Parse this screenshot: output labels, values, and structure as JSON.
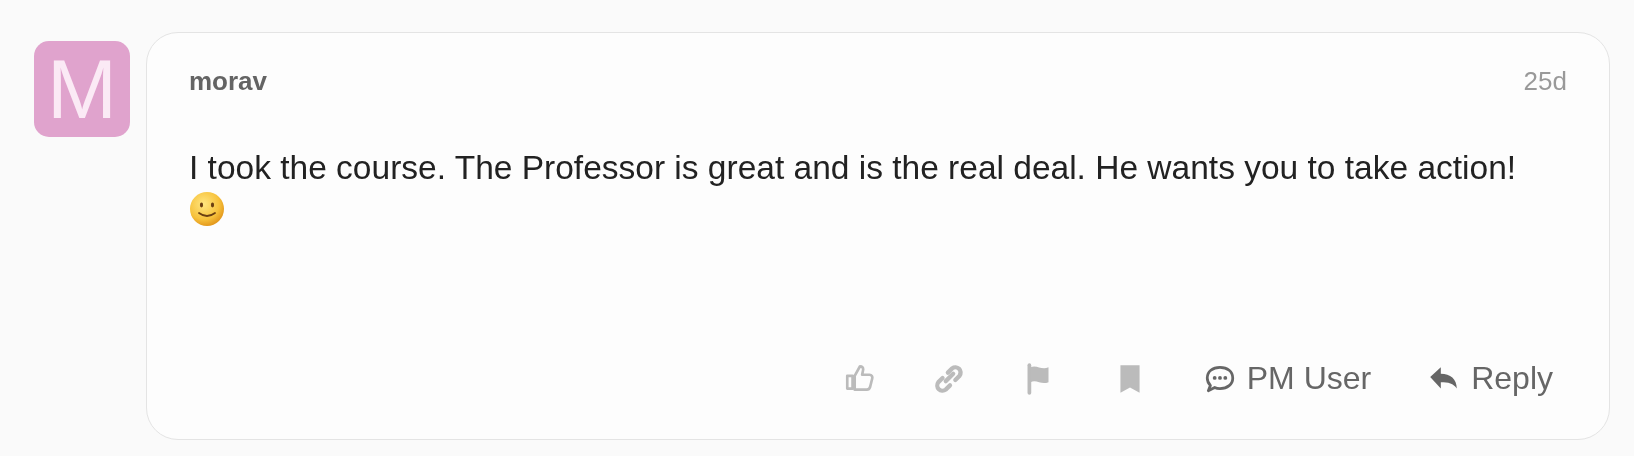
{
  "post": {
    "avatar": {
      "letter": "M",
      "color": "#e0a3cd"
    },
    "username": "morav",
    "time": "25d",
    "body": "I took the course. The Professor is great and is the real deal. He wants you to take action!",
    "actions": [
      {
        "kind": "like"
      },
      {
        "kind": "link"
      },
      {
        "kind": "flag"
      },
      {
        "kind": "bookmark"
      },
      {
        "kind": "pm",
        "label": "PM User"
      },
      {
        "kind": "reply",
        "label": "Reply"
      }
    ]
  }
}
